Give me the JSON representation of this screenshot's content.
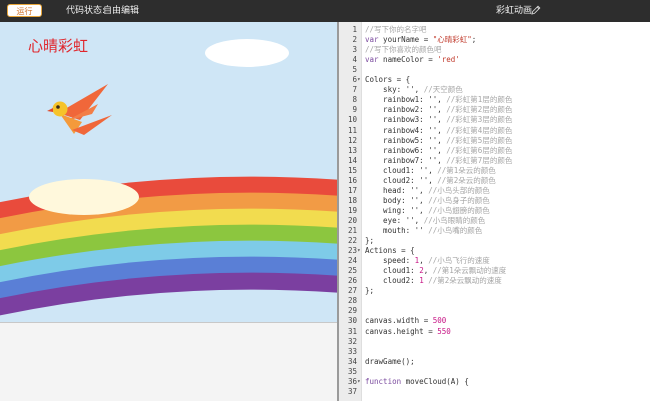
{
  "toolbar": {
    "run_label": "运行",
    "status_label": "代码状态:",
    "status_mode": "自由编辑",
    "project_title": "彩虹动画"
  },
  "preview": {
    "title_text": "心晴彩虹",
    "title_color": "#e0262c",
    "sky_color": "#cfe6f6",
    "rainbow_colors": [
      "#e94b3c",
      "#f29b45",
      "#f2dc4f",
      "#8cc63f",
      "#7ecbe8",
      "#5a7fd6",
      "#7b3fa0"
    ],
    "cloud_colors": [
      "#ffffff",
      "#fff8dc"
    ]
  },
  "editor": {
    "lines": [
      {
        "n": "1",
        "fold": "",
        "code": [
          [
            "cm",
            "//写下你的名字吧"
          ]
        ]
      },
      {
        "n": "2",
        "fold": "",
        "code": [
          [
            "kw",
            "var"
          ],
          [
            "",
            " yourName = "
          ],
          [
            "str",
            "\"心晴彩虹\""
          ],
          [
            "",
            ";"
          ]
        ]
      },
      {
        "n": "3",
        "fold": "",
        "code": [
          [
            "cm",
            "//写下你喜欢的颜色吧"
          ]
        ]
      },
      {
        "n": "4",
        "fold": "",
        "code": [
          [
            "kw",
            "var"
          ],
          [
            "",
            " nameColor = "
          ],
          [
            "str",
            "'red'"
          ]
        ]
      },
      {
        "n": "5",
        "fold": "",
        "code": [
          [
            "",
            ""
          ]
        ]
      },
      {
        "n": "6",
        "fold": "▾",
        "code": [
          [
            "",
            "Colors = {"
          ]
        ]
      },
      {
        "n": "7",
        "fold": "",
        "code": [
          [
            "",
            "    sky: '', "
          ],
          [
            "cm",
            "//天空颜色"
          ]
        ]
      },
      {
        "n": "8",
        "fold": "",
        "code": [
          [
            "",
            "    rainbow1: '', "
          ],
          [
            "cm",
            "//彩虹第1层的颜色"
          ]
        ]
      },
      {
        "n": "9",
        "fold": "",
        "code": [
          [
            "",
            "    rainbow2: '', "
          ],
          [
            "cm",
            "//彩虹第2层的颜色"
          ]
        ]
      },
      {
        "n": "10",
        "fold": "",
        "code": [
          [
            "",
            "    rainbow3: '', "
          ],
          [
            "cm",
            "//彩虹第3层的颜色"
          ]
        ]
      },
      {
        "n": "11",
        "fold": "",
        "code": [
          [
            "",
            "    rainbow4: '', "
          ],
          [
            "cm",
            "//彩虹第4层的颜色"
          ]
        ]
      },
      {
        "n": "12",
        "fold": "",
        "code": [
          [
            "",
            "    rainbow5: '', "
          ],
          [
            "cm",
            "//彩虹第5层的颜色"
          ]
        ]
      },
      {
        "n": "13",
        "fold": "",
        "code": [
          [
            "",
            "    rainbow6: '', "
          ],
          [
            "cm",
            "//彩虹第6层的颜色"
          ]
        ]
      },
      {
        "n": "14",
        "fold": "",
        "code": [
          [
            "",
            "    rainbow7: '', "
          ],
          [
            "cm",
            "//彩虹第7层的颜色"
          ]
        ]
      },
      {
        "n": "15",
        "fold": "",
        "code": [
          [
            "",
            "    cloud1: '', "
          ],
          [
            "cm",
            "//第1朵云的颜色"
          ]
        ]
      },
      {
        "n": "16",
        "fold": "",
        "code": [
          [
            "",
            "    cloud2: '', "
          ],
          [
            "cm",
            "//第2朵云的颜色"
          ]
        ]
      },
      {
        "n": "17",
        "fold": "",
        "code": [
          [
            "",
            "    head: '', "
          ],
          [
            "cm",
            "//小鸟头部的颜色"
          ]
        ]
      },
      {
        "n": "18",
        "fold": "",
        "code": [
          [
            "",
            "    body: '', "
          ],
          [
            "cm",
            "//小鸟身子的颜色"
          ]
        ]
      },
      {
        "n": "19",
        "fold": "",
        "code": [
          [
            "",
            "    wing: '', "
          ],
          [
            "cm",
            "//小鸟翅膀的颜色"
          ]
        ]
      },
      {
        "n": "20",
        "fold": "",
        "code": [
          [
            "",
            "    eye: '', "
          ],
          [
            "cm",
            "//小鸟眼睛的颜色"
          ]
        ]
      },
      {
        "n": "21",
        "fold": "",
        "code": [
          [
            "",
            "    mouth: '' "
          ],
          [
            "cm",
            "//小鸟嘴的颜色"
          ]
        ]
      },
      {
        "n": "22",
        "fold": "",
        "code": [
          [
            "",
            "};"
          ]
        ]
      },
      {
        "n": "23",
        "fold": "▾",
        "code": [
          [
            "",
            "Actions = {"
          ]
        ]
      },
      {
        "n": "24",
        "fold": "",
        "code": [
          [
            "",
            "    speed: "
          ],
          [
            "num",
            "1"
          ],
          [
            "",
            ", "
          ],
          [
            "cm",
            "//小鸟飞行的速度"
          ]
        ]
      },
      {
        "n": "25",
        "fold": "",
        "code": [
          [
            "",
            "    cloud1: "
          ],
          [
            "num",
            "2"
          ],
          [
            "",
            ", "
          ],
          [
            "cm",
            "//第1朵云飘动的速度"
          ]
        ]
      },
      {
        "n": "26",
        "fold": "",
        "code": [
          [
            "",
            "    cloud2: "
          ],
          [
            "num",
            "1"
          ],
          [
            "",
            " "
          ],
          [
            "cm",
            "//第2朵云飘动的速度"
          ]
        ]
      },
      {
        "n": "27",
        "fold": "",
        "code": [
          [
            "",
            "};"
          ]
        ]
      },
      {
        "n": "28",
        "fold": "",
        "code": [
          [
            "",
            ""
          ]
        ]
      },
      {
        "n": "29",
        "fold": "",
        "code": [
          [
            "",
            ""
          ]
        ]
      },
      {
        "n": "30",
        "fold": "",
        "code": [
          [
            "",
            "canvas.width = "
          ],
          [
            "num",
            "500"
          ]
        ]
      },
      {
        "n": "31",
        "fold": "",
        "code": [
          [
            "",
            "canvas.height = "
          ],
          [
            "num",
            "550"
          ]
        ]
      },
      {
        "n": "32",
        "fold": "",
        "code": [
          [
            "",
            ""
          ]
        ]
      },
      {
        "n": "33",
        "fold": "",
        "code": [
          [
            "",
            ""
          ]
        ]
      },
      {
        "n": "34",
        "fold": "",
        "code": [
          [
            "",
            "drawGame();"
          ]
        ]
      },
      {
        "n": "35",
        "fold": "",
        "code": [
          [
            "",
            ""
          ]
        ]
      },
      {
        "n": "36",
        "fold": "▾",
        "code": [
          [
            "kw",
            "function"
          ],
          [
            "",
            " moveCloud(A) {"
          ]
        ]
      },
      {
        "n": "37",
        "fold": "",
        "code": [
          [
            "",
            ""
          ]
        ]
      }
    ]
  }
}
